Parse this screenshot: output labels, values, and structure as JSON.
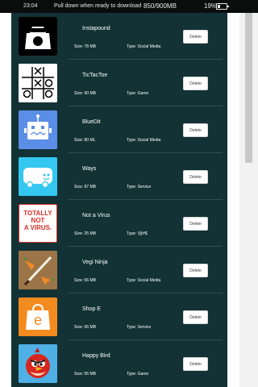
{
  "status_bar": {
    "time": "23:04",
    "message": "Pull down when ready to download",
    "storage": "850/900MB",
    "battery": "19%"
  },
  "delete_label": "Delete",
  "apps": [
    {
      "name": "Instapound",
      "size": "Size: 78 MB",
      "type": "Type: Social Media",
      "icon": "camera-bag-icon",
      "icon_bg": "#ffffff"
    },
    {
      "name": "TicTacToe",
      "size": "Size: 90 MB",
      "type": "Type: Game",
      "icon": "tic-tac-toe-icon",
      "icon_bg": "#ffffff"
    },
    {
      "name": "BlueDit",
      "size": "Size: 80 ML",
      "type": "Type: Social Media",
      "icon": "robot-icon",
      "icon_bg": "#5b8ee6"
    },
    {
      "name": "Ways",
      "size": "Size: 87 MB",
      "type": "Type: Service",
      "icon": "bus-icon",
      "icon_bg": "#34c7ef"
    },
    {
      "name": "Not a Virus",
      "size": "Size: 25 MB",
      "type": "Type: !@#$",
      "icon": "not-a-virus-icon",
      "icon_bg": "#ffffff",
      "icon_text": [
        "TOTALLY",
        "NOT",
        "A VIRUS."
      ]
    },
    {
      "name": "Vegi Ninja",
      "size": "Size: 56 MB",
      "type": "Type: Social Media",
      "icon": "carrot-sword-icon",
      "icon_bg": "#9b7548"
    },
    {
      "name": "Shop E",
      "size": "Size: 66 MB",
      "type": "Type: Service",
      "icon": "shopping-bag-icon",
      "icon_bg": "#f48b1f",
      "icon_letter": "e"
    },
    {
      "name": "Happy Bird",
      "size": "Size: 56 MB",
      "type": "Type: Game",
      "icon": "angry-bird-icon",
      "icon_bg": "#4fb0e6"
    }
  ]
}
